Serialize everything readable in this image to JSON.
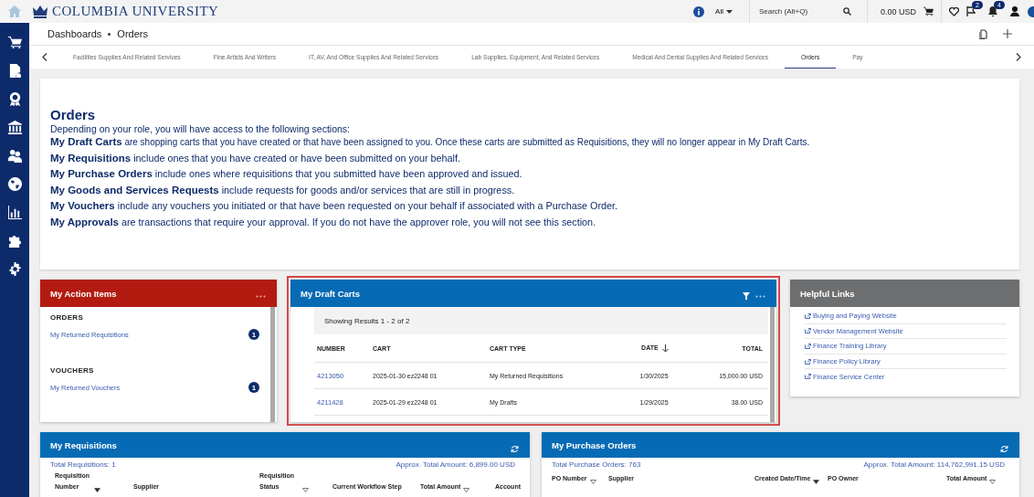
{
  "header": {
    "logo": "COLUMBIA UNIVERSITY",
    "scope": "All",
    "search": {
      "placeholder": "Search (Alt+Q)"
    },
    "cart_total": "0.00 USD",
    "flag_count": "2",
    "notification_count": "4"
  },
  "breadcrumb": [
    "Dashboards",
    "Orders"
  ],
  "tabs": [
    {
      "label": "Facilities Supplies And Related Services",
      "selected": false
    },
    {
      "label": "Fine Artists And Writers",
      "selected": false
    },
    {
      "label": "IT, AV, And Office Supplies And Related Services",
      "selected": false
    },
    {
      "label": "Lab Supplies, Equipment, And Related Services",
      "selected": false
    },
    {
      "label": "Medical And Dental Supplies And Related Services",
      "selected": false
    },
    {
      "label": "Orders",
      "selected": true
    },
    {
      "label": "Pay",
      "selected": false
    }
  ],
  "intro": {
    "title": "Orders",
    "lead": "Depending on your role, you will have access to the following sections:",
    "lines": [
      "**My Draft Carts** are shopping carts that you have created or that have been assigned to you. Once these carts are submitted as Requisitions, they will no longer appear in My Draft Carts.",
      "**My Requisitions** include ones that you have created or have been submitted on your behalf.",
      "**My Purchase Orders** include ones where requisitions that you submitted have been approved and issued.",
      "**My Goods and Services Requests** include requests for goods and/or services that are still in progress.",
      "**My Vouchers** include any vouchers you initiated or that have been requested on your behalf if associated with a Purchase Order.",
      "**My Approvals** are transactions that require your approval. If you do not have the approver role, you will not see this section."
    ]
  },
  "action_items": {
    "title": "My Action Items",
    "sections": [
      {
        "heading": "ORDERS",
        "items": [
          {
            "label": "My Returned Requisitions",
            "count": "1"
          }
        ]
      },
      {
        "heading": "VOUCHERS",
        "items": [
          {
            "label": "My Returned Vouchers",
            "count": "1"
          }
        ]
      }
    ]
  },
  "draft_carts": {
    "title": "My Draft Carts",
    "results": "Showing Results 1 - 2 of 2",
    "columns": [
      "NUMBER",
      "CART",
      "CART TYPE",
      "DATE",
      "TOTAL"
    ],
    "rows": [
      [
        "4213050",
        "2025-01-30 ez2248 01",
        "My Returned Requisitions",
        "1/30/2025",
        "15,000.00 USD"
      ],
      [
        "4211428",
        "2025-01-29 ez2248 01",
        "My Drafts",
        "1/29/2025",
        "38.00 USD"
      ]
    ]
  },
  "helpful_links": {
    "title": "Helpful Links",
    "links": [
      "Buying and Paying Website",
      "Vendor Management Website",
      "Finance Training Library",
      "Finance Policy Library",
      "Finance Service Center"
    ]
  },
  "requisitions": {
    "title": "My Requisitions",
    "total": "Total Requisitions: 1",
    "amount": "Approx. Total Amount: 6,899.00 USD",
    "columns": [
      {
        "label": "Requisition Number",
        "sorted": true
      },
      {
        "label": "Supplier"
      },
      {
        "label": "Requisition Status",
        "sorted": false
      },
      {
        "label": "Current Workflow Step"
      },
      {
        "label": "Total Amount",
        "sorted": false
      },
      {
        "label": "Account"
      }
    ]
  },
  "purchase_orders": {
    "title": "My Purchase Orders",
    "total": "Total Purchase Orders: 763",
    "amount": "Approx. Total Amount: 114,762,991.15 USD",
    "columns": [
      {
        "label": "PO Number",
        "sorted": false
      },
      {
        "label": "Supplier"
      },
      {
        "label": "Created Date/Time",
        "sorted": true
      },
      {
        "label": "PO Owner"
      },
      {
        "label": "Total Amount",
        "sorted": false
      }
    ]
  }
}
